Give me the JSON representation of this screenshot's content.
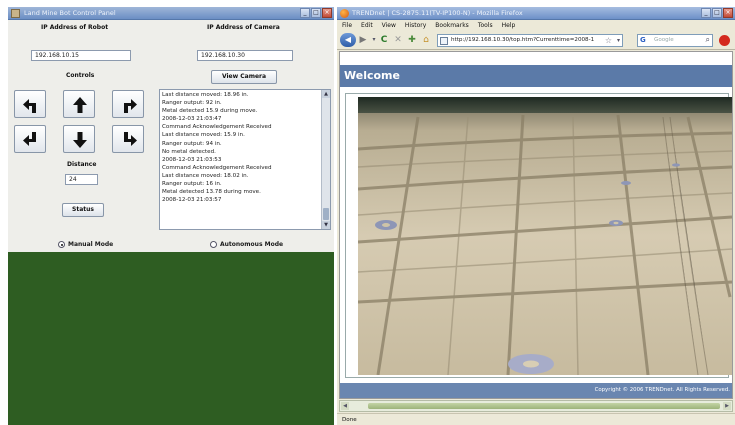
{
  "control_panel": {
    "title": "Land Mine Bot Control Panel",
    "robot_ip_label": "IP Address of Robot",
    "robot_ip_value": "192.168.10.15",
    "camera_ip_label": "IP Address of Camera",
    "camera_ip_value": "192.168.10.30",
    "controls_label": "Controls",
    "view_camera_label": "View Camera",
    "distance_label": "Distance",
    "distance_value": "24",
    "status_label": "Status",
    "manual_mode_label": "Manual Mode",
    "autonomous_mode_label": "Autonomous Mode",
    "selected_mode": "manual",
    "log_lines": [
      "Last distance moved: 18.96 in.",
      "Ranger output: 92 in.",
      "Metal detected 15.9 during move.",
      "2008-12-03 21:03:47",
      "Command Acknowledgement Received",
      "Last distance moved: 15.9 in.",
      "Ranger output: 94 in.",
      "No metal detected.",
      "2008-12-03 21:03:53",
      "Command Acknowledgement Received",
      "Last distance moved: 18.02 in.",
      "Ranger output: 16 in.",
      "Metal detected 13.78 during move.",
      "2008-12-03 21:03:57"
    ]
  },
  "browser": {
    "title": "TRENDnet | CS-2875.11(TV-IP100-N) - Mozilla Firefox",
    "menu": [
      "File",
      "Edit",
      "View",
      "History",
      "Bookmarks",
      "Tools",
      "Help"
    ],
    "url": "http://192.168.10.30/top.htm?Currenttime=2008-1",
    "search_engine": "G",
    "search_placeholder": "Google",
    "page": {
      "welcome": "Welcome",
      "copyright": "Copyright © 2006 TRENDnet. All Rights Reserved."
    },
    "status_text": "Done"
  },
  "colors": {
    "panel_bg": "#eeeeea",
    "desktop_green": "#2e5d22",
    "welcome_bar": "#5b7aa8",
    "footer_bar": "#6a86b0"
  }
}
